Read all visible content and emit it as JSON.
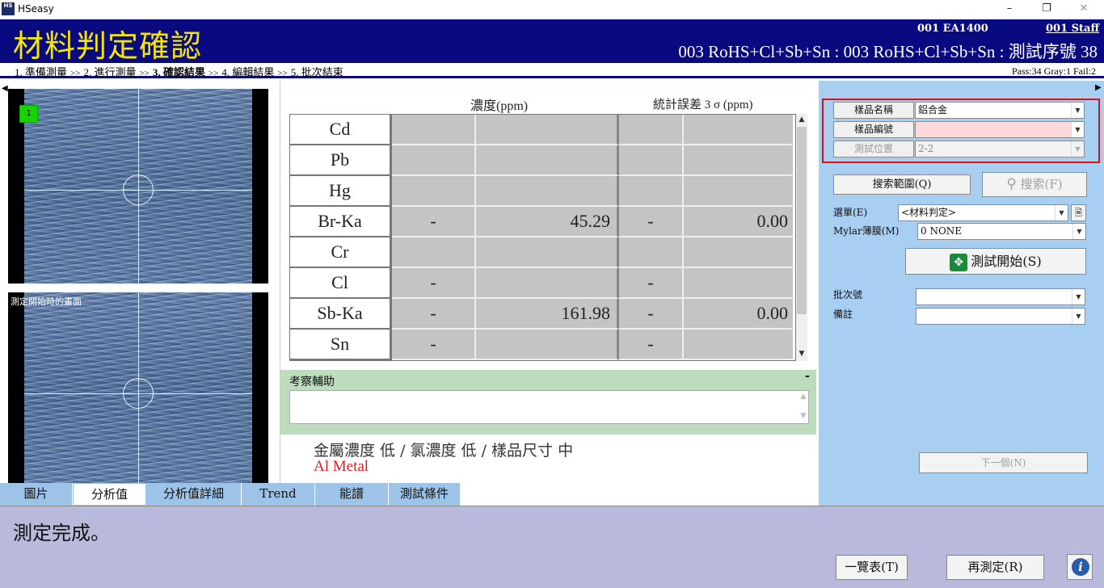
{
  "window": {
    "app_icon": "HS",
    "title": "HSeasy",
    "minimize": "–",
    "restore": "❐",
    "close": "✕"
  },
  "header": {
    "title": "材料判定確認",
    "device": "001 EA1400",
    "staff": "001 Staff",
    "method_line": "003 RoHS+Cl+Sb+Sn : 003 RoHS+Cl+Sb+Sn : 測試序號 38"
  },
  "breadcrumb": {
    "steps": [
      "1. 準備測量",
      "2. 進行測量",
      "3. 確認結果",
      "4. 編輯結果",
      "5. 批次結束"
    ],
    "separator": ">>",
    "current_index": 2,
    "pass": "Pass:34",
    "gray": "Gray:1",
    "fail": "Fail:2"
  },
  "images": {
    "marker": "1",
    "second_label": "測定開始時的畫面"
  },
  "results": {
    "concentration_header": "濃度(ppm)",
    "error_header": "統計誤差 3 σ (ppm)",
    "rows": [
      {
        "element": "Cd",
        "c1": "",
        "c2": "",
        "e1": "",
        "e2": ""
      },
      {
        "element": "Pb",
        "c1": "",
        "c2": "",
        "e1": "",
        "e2": ""
      },
      {
        "element": "Hg",
        "c1": "",
        "c2": "",
        "e1": "",
        "e2": ""
      },
      {
        "element": "Br-Ka",
        "c1": "-",
        "c2": "45.29",
        "e1": "-",
        "e2": "0.00"
      },
      {
        "element": "Cr",
        "c1": "",
        "c2": "",
        "e1": "",
        "e2": ""
      },
      {
        "element": "Cl",
        "c1": "-",
        "c2": "",
        "e1": "-",
        "e2": ""
      },
      {
        "element": "Sb-Ka",
        "c1": "-",
        "c2": "161.98",
        "e1": "-",
        "e2": "0.00"
      },
      {
        "element": "Sn",
        "c1": "-",
        "c2": "",
        "e1": "-",
        "e2": ""
      }
    ]
  },
  "remark": {
    "title": "考察輔助",
    "collapse": "-"
  },
  "judgement": {
    "summary": "金屬濃度 低 / 氯濃度 低 / 樣品尺寸 中",
    "material": "Al Metal"
  },
  "tabs": [
    "圖片",
    "分析值",
    "分析值詳細",
    "Trend",
    "能譜",
    "測試條件"
  ],
  "active_tab": 1,
  "right": {
    "sample_name_label": "樣品名稱",
    "sample_name_value": "鋁合金",
    "sample_no_label": "樣品編號",
    "sample_no_value": "",
    "position_label": "測試位置",
    "position_value": "2-2",
    "search_range_button": "搜索範圍(Q)",
    "search_button": "搜索(F)",
    "menu_label": "選單(E)",
    "menu_value": "<材料判定>",
    "mylar_label": "Mylar薄膜(M)",
    "mylar_value": "0 NONE",
    "start_button": "測試開始(S)",
    "lot_label": "批次號",
    "lot_value": "",
    "note_label": "備註",
    "note_value": "",
    "next_button": "下一個(N)"
  },
  "status": {
    "message": "測定完成。",
    "list_button": "一覽表(T)",
    "remeasure_button": "再測定(R)",
    "info_icon": "i"
  },
  "colors": {
    "header_bg": "#0a0a80",
    "title_yellow": "#f5e600",
    "right_panel": "#a8cff2",
    "status_bg": "#b9b9db",
    "highlight_red": "#e01010",
    "material_red": "#e02020"
  }
}
